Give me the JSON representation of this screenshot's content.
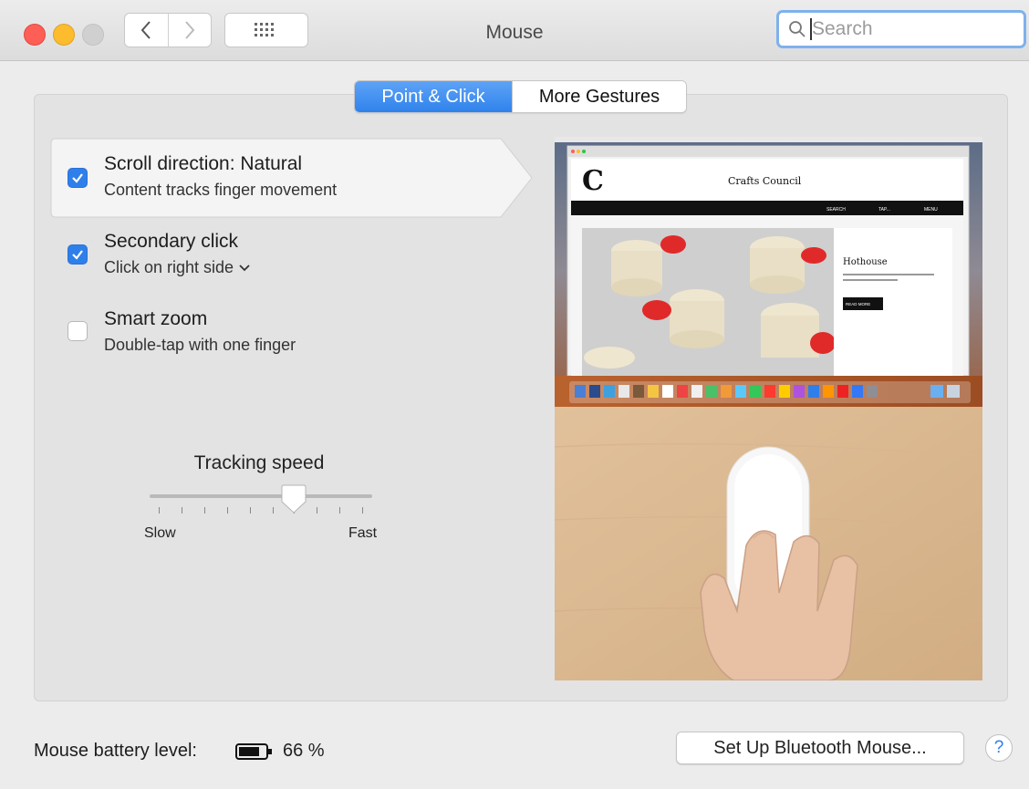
{
  "window": {
    "title": "Mouse"
  },
  "search": {
    "placeholder": "Search"
  },
  "tabs": [
    {
      "label": "Point & Click",
      "active": true
    },
    {
      "label": "More Gestures",
      "active": false
    }
  ],
  "options": [
    {
      "label": "Scroll direction: Natural",
      "sublabel": "Content tracks finger movement",
      "checked": true
    },
    {
      "label": "Secondary click",
      "sublabel": "Click on right side",
      "checked": true
    },
    {
      "label": "Smart zoom",
      "sublabel": "Double-tap with one finger",
      "checked": false
    }
  ],
  "tracking": {
    "title": "Tracking speed",
    "min_label": "Slow",
    "max_label": "Fast",
    "level_fraction": 0.65
  },
  "preview": {
    "site_title": "Crafts Council",
    "article_title": "Hothouse",
    "nav_items": [
      "SEARCH",
      "TAP...",
      "MENU"
    ],
    "button": "READ MORE"
  },
  "footer": {
    "battery_label": "Mouse battery level:",
    "battery_percent": "66 %",
    "setup_button": "Set Up Bluetooth Mouse...",
    "help": "?"
  },
  "colors": {
    "accent": "#2f7fea",
    "close": "#fd5f57",
    "minimize": "#fdbc2e",
    "zoom_disabled": "#d0d0d0"
  }
}
